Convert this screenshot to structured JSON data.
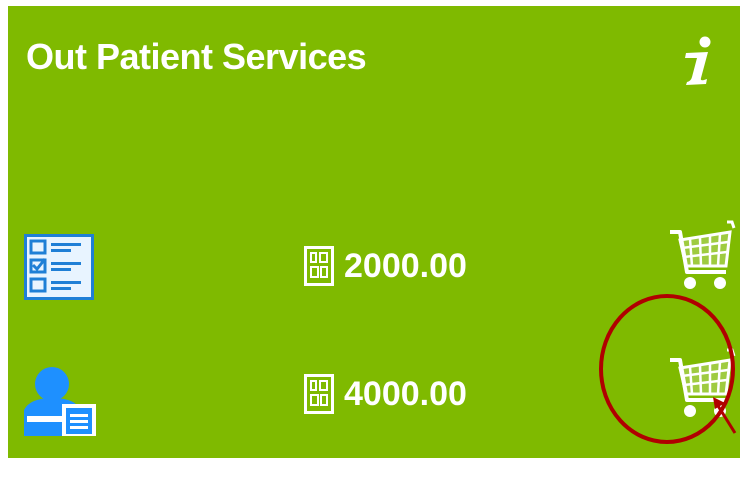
{
  "panel": {
    "title": "Out Patient Services",
    "info_icon": "info-icon",
    "background_color": "#7fba00"
  },
  "services": [
    {
      "icon": "checklist-icon",
      "price": "2000.00",
      "price_icon": "price-tag-icon",
      "cart_icon": "add-to-cart-icon"
    },
    {
      "icon": "doctor-report-icon",
      "price": "4000.00",
      "price_icon": "price-tag-icon",
      "cart_icon": "add-to-cart-icon"
    }
  ],
  "annotation": {
    "highlight_color": "#b00000",
    "target": "row 2 cart"
  }
}
